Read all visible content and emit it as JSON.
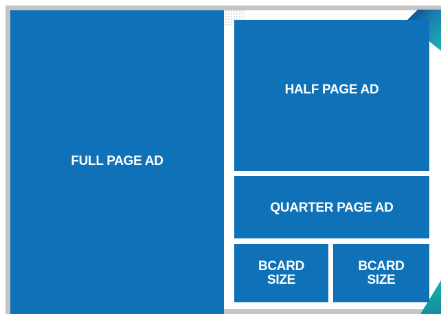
{
  "layout_diagram": {
    "ads": {
      "full_page": {
        "label": "FULL PAGE AD"
      },
      "half_page": {
        "label": "HALF PAGE AD"
      },
      "quarter_page": {
        "label": "QUARTER PAGE AD"
      },
      "bcard_left": {
        "line1": "BCARD",
        "line2": "SIZE"
      },
      "bcard_right": {
        "line1": "BCARD",
        "line2": "SIZE"
      }
    }
  },
  "colors": {
    "ad_blue": "#0f72b9",
    "frame_gray": "#c4c4c4",
    "accent_teal": "#1fb3b0",
    "accent_navy": "#0a3f86"
  }
}
